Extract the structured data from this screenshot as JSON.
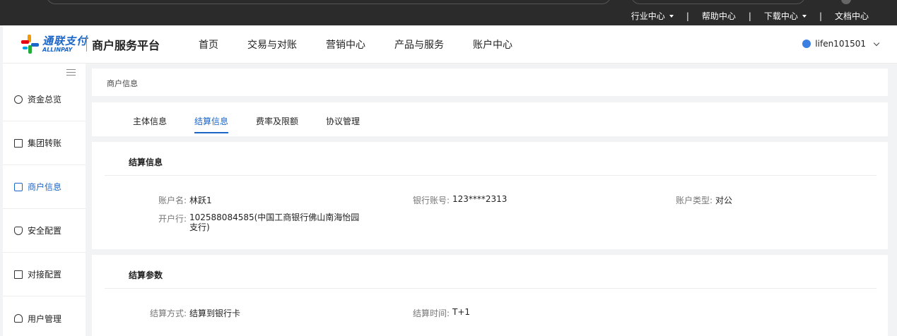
{
  "toplinks": {
    "industry": "行业中心",
    "help": "帮助中心",
    "download": "下载中心",
    "docs": "文档中心",
    "separator": "|"
  },
  "header": {
    "logo_cn": "通联支付",
    "logo_en": "ALLINPAY",
    "platform_title": "商户服务平台",
    "nav": [
      "首页",
      "交易与对账",
      "营销中心",
      "产品与服务",
      "账户中心"
    ],
    "username": "lifen101501"
  },
  "sidebar": {
    "items": [
      {
        "label": "资金总览",
        "icon": "clock-icon"
      },
      {
        "label": "集团转账",
        "icon": "transfer-doc-icon"
      },
      {
        "label": "商户信息",
        "icon": "merchant-icon"
      },
      {
        "label": "安全配置",
        "icon": "shield-icon"
      },
      {
        "label": "对接配置",
        "icon": "connect-icon"
      },
      {
        "label": "用户管理",
        "icon": "user-icon"
      }
    ],
    "active_index": 2
  },
  "breadcrumb": "商户信息",
  "tabs": {
    "items": [
      "主体信息",
      "结算信息",
      "费率及限额",
      "协议管理"
    ],
    "active_index": 1
  },
  "settlement_info": {
    "title": "结算信息",
    "account_name_label": "账户名:",
    "account_name": "林跃1",
    "bank_account_label": "银行账号:",
    "bank_account": "123****2313",
    "account_type_label": "账户类型:",
    "account_type": "对公",
    "opening_bank_label": "开户行:",
    "opening_bank_line1": "102588084585(中国工商银行佛山南海怡园",
    "opening_bank_line2": "支行)"
  },
  "settlement_params": {
    "title": "结算参数",
    "method_label": "结算方式:",
    "method": "结算到银行卡",
    "time_label": "结算时间:",
    "time": "T+1"
  },
  "colors": {
    "accent": "#1a66c9",
    "topbar": "#2b2b2b",
    "page_bg": "#f2f3f5"
  }
}
